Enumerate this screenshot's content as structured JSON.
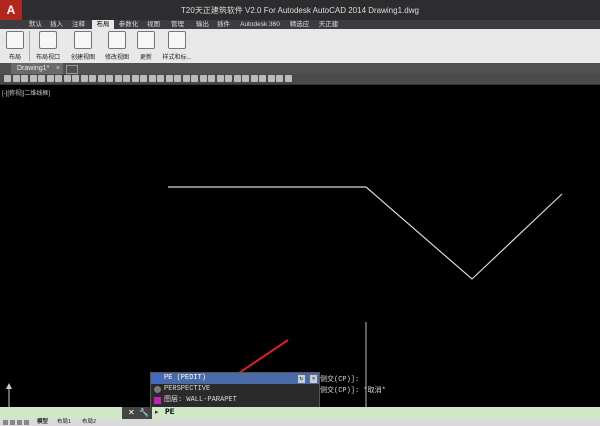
{
  "app": {
    "logo": "A",
    "title": "T20天正建筑软件 V2.0 For Autodesk AutoCAD 2014    Drawing1.dwg"
  },
  "menu": {
    "items": [
      "默认",
      "插入",
      "注释",
      "布局",
      "参数化",
      "视图",
      "管理",
      "输出",
      "插件",
      "Autodesk 360",
      "精选应用",
      "天正建筑"
    ],
    "active_label": "布局"
  },
  "ribbon": {
    "buttons": [
      "布局",
      "布局视口",
      "创建视图",
      "修改视图",
      "更新",
      "样式和标..."
    ]
  },
  "document_tab": {
    "label": "Drawing1*",
    "close": "×"
  },
  "viewport": {
    "label": "[-][俯视][二维线框]"
  },
  "autocomplete": {
    "items": [
      {
        "text": "PE (PEDIT)",
        "selected": true,
        "icon_color": "#3a6ad4"
      },
      {
        "text": "PERSPECTIVE",
        "selected": false,
        "icon_color": "#7a7a7a"
      },
      {
        "text": "图层: WALL-PARAPET",
        "selected": false,
        "icon_color": "#c020c0"
      }
    ],
    "buttons": [
      "↻",
      "✕"
    ]
  },
  "history": {
    "lines": [
      "侧交(CP)]:",
      "侧交(CP)]: *取消*"
    ]
  },
  "command": {
    "close_icon": "✕",
    "wrench_icon": "🔧",
    "prompt": "▸",
    "input": "PE"
  },
  "status": {
    "tabs": [
      "模型",
      "布局1",
      "布局2"
    ]
  },
  "colors": {
    "canvas": "#000000",
    "linework": "#d8d8d8",
    "arrow": "#e02020",
    "command_bar": "#cfe8c8"
  },
  "icons": {
    "logo": "autocad-logo-icon",
    "close": "close-icon",
    "wrench": "wrench-icon",
    "ucs": "ucs-axis-icon"
  }
}
